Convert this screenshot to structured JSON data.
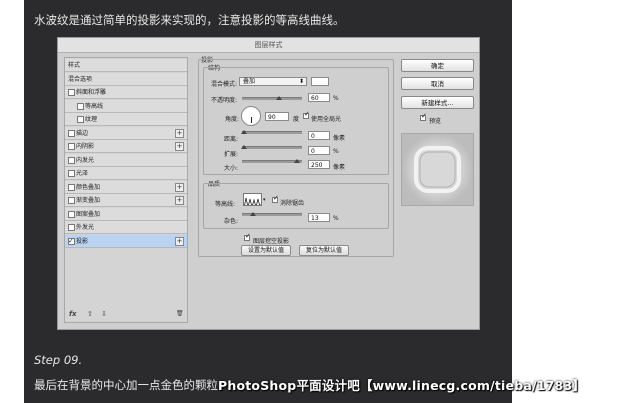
{
  "tutorial": {
    "top_text": "水波纹是通过简单的投影来实现的，注意投影的等高线曲线。",
    "step_label": "Step 09.",
    "step_text": "最后在背景的中心加一点金色的颗粒",
    "watermark": "PhotoShop平面设计吧【www.linecg.com/tieba/1783】"
  },
  "dialog": {
    "title": "图层样式",
    "styles_list": [
      {
        "label": "样式",
        "checkbox": false,
        "checked": false,
        "plus": false,
        "sub": false,
        "selected": false
      },
      {
        "label": "混合选项",
        "checkbox": false,
        "checked": false,
        "plus": false,
        "sub": false,
        "selected": false
      },
      {
        "label": "斜面和浮雕",
        "checkbox": true,
        "checked": false,
        "plus": false,
        "sub": false,
        "selected": false
      },
      {
        "label": "等高线",
        "checkbox": true,
        "checked": false,
        "plus": false,
        "sub": true,
        "selected": false
      },
      {
        "label": "纹理",
        "checkbox": true,
        "checked": false,
        "plus": false,
        "sub": true,
        "selected": false
      },
      {
        "label": "描边",
        "checkbox": true,
        "checked": false,
        "plus": true,
        "sub": false,
        "selected": false
      },
      {
        "label": "内阴影",
        "checkbox": true,
        "checked": false,
        "plus": true,
        "sub": false,
        "selected": false
      },
      {
        "label": "内发光",
        "checkbox": true,
        "checked": false,
        "plus": false,
        "sub": false,
        "selected": false
      },
      {
        "label": "光泽",
        "checkbox": true,
        "checked": false,
        "plus": false,
        "sub": false,
        "selected": false
      },
      {
        "label": "颜色叠加",
        "checkbox": true,
        "checked": false,
        "plus": true,
        "sub": false,
        "selected": false
      },
      {
        "label": "渐变叠加",
        "checkbox": true,
        "checked": false,
        "plus": true,
        "sub": false,
        "selected": false
      },
      {
        "label": "图案叠加",
        "checkbox": true,
        "checked": false,
        "plus": false,
        "sub": false,
        "selected": false
      },
      {
        "label": "外发光",
        "checkbox": true,
        "checked": false,
        "plus": false,
        "sub": false,
        "selected": false
      },
      {
        "label": "投影",
        "checkbox": true,
        "checked": true,
        "plus": true,
        "sub": false,
        "selected": true
      }
    ],
    "footer_icons": {
      "fx": "fx",
      "up": "⇧",
      "down": "⇩",
      "trash": "🗑"
    },
    "drop_shadow": {
      "section_title": "投影",
      "structure_title": "结构",
      "blend_mode_label": "混合模式:",
      "blend_mode_value": "叠加",
      "opacity_label": "不透明度:",
      "opacity_value": "60",
      "percent": "%",
      "angle_label": "角度:",
      "angle_value": "90",
      "angle_unit": "度",
      "global_light_label": "使用全局光",
      "global_light_checked": true,
      "distance_label": "距离:",
      "distance_value": "0",
      "pixel_unit": "像素",
      "spread_label": "扩展:",
      "spread_value": "0",
      "size_label": "大小:",
      "size_value": "250",
      "quality_title": "品质",
      "contour_label": "等高线:",
      "antialias_label": "消除锯齿",
      "antialias_checked": true,
      "noise_label": "杂色:",
      "noise_value": "13",
      "layer_knocks_label": "图层挖空投影",
      "layer_knocks_checked": true,
      "make_default": "设置为默认值",
      "reset_default": "复位为默认值"
    },
    "buttons": {
      "ok": "确定",
      "cancel": "取消",
      "new_style": "新建样式...",
      "preview_label": "预览",
      "preview_checked": true
    }
  }
}
